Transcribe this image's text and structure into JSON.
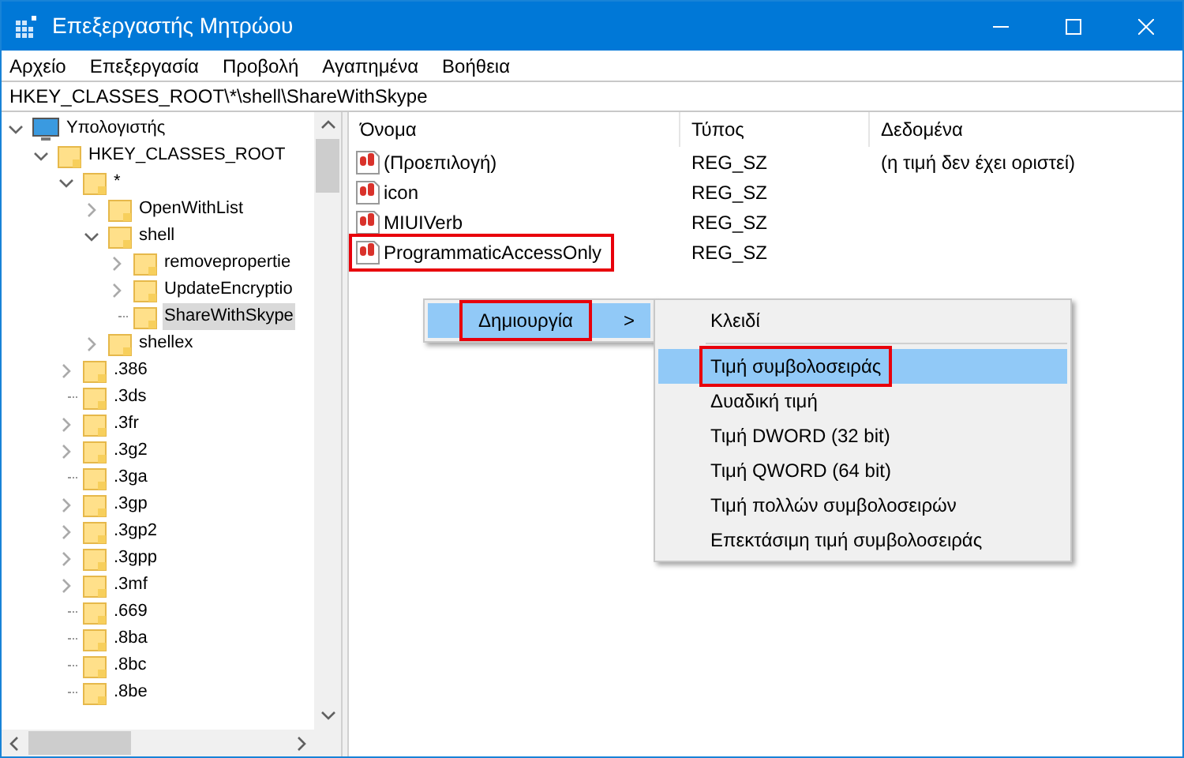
{
  "window": {
    "title": "Επεξεργαστής Μητρώου"
  },
  "menu": [
    "Αρχείο",
    "Επεξεργασία",
    "Προβολή",
    "Αγαπημένα",
    "Βοήθεια"
  ],
  "address": "HKEY_CLASSES_ROOT\\*\\shell\\ShareWithSkype",
  "tree": [
    {
      "label": "Υπολογιστής",
      "kind": "computer",
      "expanded": true,
      "selected": false,
      "children": [
        {
          "label": "HKEY_CLASSES_ROOT",
          "kind": "folder",
          "expanded": true,
          "selected": false,
          "children": [
            {
              "label": "*",
              "kind": "folder",
              "expanded": true,
              "selected": false,
              "children": [
                {
                  "label": "OpenWithList",
                  "kind": "folder",
                  "expanded": false,
                  "selected": false
                },
                {
                  "label": "shell",
                  "kind": "folder",
                  "expanded": true,
                  "selected": false,
                  "children": [
                    {
                      "label": "removepropertie",
                      "kind": "folder",
                      "expanded": false,
                      "selected": false
                    },
                    {
                      "label": "UpdateEncryptio",
                      "kind": "folder",
                      "expanded": false,
                      "selected": false
                    },
                    {
                      "label": "ShareWithSkype",
                      "kind": "folder",
                      "selected": true
                    }
                  ]
                },
                {
                  "label": "shellex",
                  "kind": "folder",
                  "expanded": false,
                  "selected": false
                }
              ]
            },
            {
              "label": ".386",
              "kind": "folder",
              "expanded": false,
              "selected": false
            },
            {
              "label": ".3ds",
              "kind": "folder",
              "selected": false
            },
            {
              "label": ".3fr",
              "kind": "folder",
              "expanded": false,
              "selected": false
            },
            {
              "label": ".3g2",
              "kind": "folder",
              "expanded": false,
              "selected": false
            },
            {
              "label": ".3ga",
              "kind": "folder",
              "selected": false
            },
            {
              "label": ".3gp",
              "kind": "folder",
              "expanded": false,
              "selected": false
            },
            {
              "label": ".3gp2",
              "kind": "folder",
              "expanded": false,
              "selected": false
            },
            {
              "label": ".3gpp",
              "kind": "folder",
              "expanded": false,
              "selected": false
            },
            {
              "label": ".3mf",
              "kind": "folder",
              "expanded": false,
              "selected": false
            },
            {
              "label": ".669",
              "kind": "folder",
              "selected": false
            },
            {
              "label": ".8ba",
              "kind": "folder",
              "selected": false
            },
            {
              "label": ".8bc",
              "kind": "folder",
              "selected": false
            },
            {
              "label": ".8be",
              "kind": "folder",
              "selected": false
            }
          ]
        }
      ]
    }
  ],
  "values": {
    "columns": [
      "Όνομα",
      "Τύπος",
      "Δεδομένα"
    ],
    "rows": [
      {
        "name": "(Προεπιλογή)",
        "type": "REG_SZ",
        "data": "(η τιμή δεν έχει οριστεί)",
        "highlighted": false
      },
      {
        "name": "icon",
        "type": "REG_SZ",
        "highlighted": false
      },
      {
        "name": "MIUIVerb",
        "type": "REG_SZ",
        "highlighted": false
      },
      {
        "name": "ProgrammaticAccessOnly",
        "type": "REG_SZ",
        "highlighted": true
      }
    ]
  },
  "context_menu": {
    "items": [
      {
        "label": "Δημιουργία",
        "arrow": ">",
        "selected": true,
        "highlighted": true
      }
    ],
    "submenu": [
      {
        "kind": "item",
        "label": "Κλειδί",
        "selected": false,
        "highlighted": false
      },
      {
        "kind": "separator"
      },
      {
        "kind": "item",
        "label": "Τιμή συμβολοσειράς",
        "selected": true,
        "highlighted": true
      },
      {
        "kind": "item",
        "label": "Δυαδική τιμή",
        "selected": false,
        "highlighted": false
      },
      {
        "kind": "item",
        "label": "Τιμή DWORD (32 bit)",
        "selected": false,
        "highlighted": false
      },
      {
        "kind": "item",
        "label": "Τιμή QWORD (64 bit)",
        "selected": false,
        "highlighted": false
      },
      {
        "kind": "item",
        "label": "Τιμή πολλών συμβολοσειρών",
        "selected": false,
        "highlighted": false
      },
      {
        "kind": "item",
        "label": "Επεκτάσιμη τιμή συμβολοσειράς",
        "selected": false,
        "highlighted": false
      }
    ]
  }
}
